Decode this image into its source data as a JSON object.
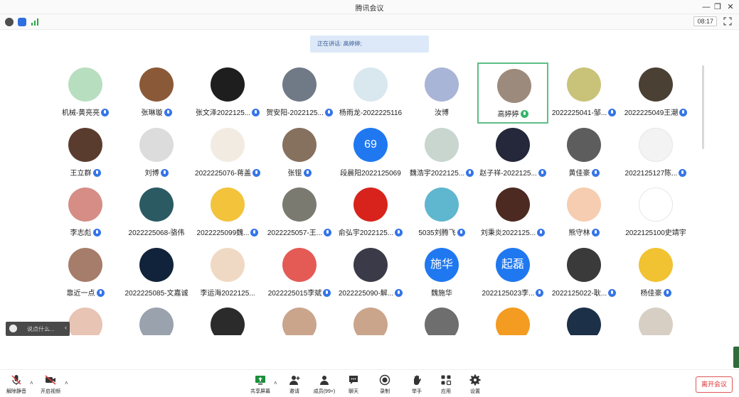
{
  "window": {
    "title": "腾讯会议"
  },
  "subbar": {
    "time": "08:17"
  },
  "speaking": {
    "text": "正在讲话: 高婷婷;"
  },
  "participants": [
    {
      "name": "机械-黄亮亮",
      "color": "#b8dec0",
      "mic": "blue"
    },
    {
      "name": "张琳璇",
      "color": "#8a5a38",
      "mic": "blue"
    },
    {
      "name": "张文泽2022125...",
      "color": "#1e1e1e",
      "mic": "blue"
    },
    {
      "name": "贺安阳-2022125...",
      "color": "#6f7a86",
      "mic": "blue"
    },
    {
      "name": "杨雨龙-2022225116",
      "color": "#d9e7ee",
      "mic": ""
    },
    {
      "name": "汝博",
      "color": "#a9b5d6",
      "mic": ""
    },
    {
      "name": "高婷婷",
      "color": "#9c8a7c",
      "mic": "green",
      "active": true
    },
    {
      "name": "2022225041-邹...",
      "color": "#c9c37a",
      "mic": "blue"
    },
    {
      "name": "2022225049王潮",
      "color": "#4a4034",
      "mic": "blue"
    },
    {
      "name": "王立群",
      "color": "#5a3c2e",
      "mic": "blue"
    },
    {
      "name": "刘博",
      "color": "#dcdcdc",
      "mic": "blue"
    },
    {
      "name": "2022225076-蒋盖",
      "color": "#f1ebe2",
      "mic": "blue"
    },
    {
      "name": "张锟",
      "color": "#86705e",
      "mic": "blue"
    },
    {
      "name": "段晨阳2022125069",
      "color": "#1f78f0",
      "mic": "",
      "text": "69"
    },
    {
      "name": "魏浩宇2022125...",
      "color": "#c8d6cf",
      "mic": "blue"
    },
    {
      "name": "赵子祥-2022125...",
      "color": "#24283a",
      "mic": "blue"
    },
    {
      "name": "黄佳豪",
      "color": "#5d5d5d",
      "mic": "blue"
    },
    {
      "name": "2022125127陈...",
      "color": "#f3f3f3",
      "mic": "blue"
    },
    {
      "name": "李志彪",
      "color": "#d58d86",
      "mic": "blue"
    },
    {
      "name": "2022225068-骆伟",
      "color": "#2b5a63",
      "mic": ""
    },
    {
      "name": "2022225099魏...",
      "color": "#f2c33b",
      "mic": "blue"
    },
    {
      "name": "2022225057-王...",
      "color": "#7a7a70",
      "mic": "blue"
    },
    {
      "name": "俞弘宇2022125...",
      "color": "#d8231c",
      "mic": "blue"
    },
    {
      "name": "5035刘腾飞",
      "color": "#5fb6cf",
      "mic": "blue"
    },
    {
      "name": "刘秉炎2022125...",
      "color": "#4c2a22",
      "mic": "blue"
    },
    {
      "name": "熊守林",
      "color": "#f6cdb0",
      "mic": "blue"
    },
    {
      "name": "2022125100史靖宇",
      "color": "#ffffff",
      "mic": ""
    },
    {
      "name": "靠近一点",
      "color": "#a67c6a",
      "mic": "blue"
    },
    {
      "name": "2022225085-文嘉诚",
      "color": "#11233a",
      "mic": ""
    },
    {
      "name": "李运海2022125...",
      "color": "#f0d9c4",
      "mic": ""
    },
    {
      "name": "2022225015李斌",
      "color": "#e45b55",
      "mic": "blue"
    },
    {
      "name": "2022225090-解...",
      "color": "#3b3a48",
      "mic": "blue"
    },
    {
      "name": "魏施华",
      "color": "#1f78f0",
      "mic": "",
      "text": "施华"
    },
    {
      "name": "2022125023李...",
      "color": "#1f78f0",
      "mic": "blue",
      "text": "起磊"
    },
    {
      "name": "2022125022-耿...",
      "color": "#3a3a3a",
      "mic": "blue"
    },
    {
      "name": "杨佳豪",
      "color": "#f1c231",
      "mic": "blue"
    },
    {
      "name": "",
      "color": "#e8c4b4",
      "mic": ""
    },
    {
      "name": "",
      "color": "#9aa3ad",
      "mic": ""
    },
    {
      "name": "",
      "color": "#2b2b2b",
      "mic": ""
    },
    {
      "name": "",
      "color": "#caa58c",
      "mic": ""
    },
    {
      "name": "",
      "color": "#caa58c",
      "mic": ""
    },
    {
      "name": "",
      "color": "#6e6e6e",
      "mic": ""
    },
    {
      "name": "",
      "color": "#f39c21",
      "mic": ""
    },
    {
      "name": "",
      "color": "#1c3148",
      "mic": ""
    },
    {
      "name": "",
      "color": "#d7cfc4",
      "mic": ""
    }
  ],
  "chat": {
    "placeholder": "说点什么..."
  },
  "toolbar": {
    "mute": "解除静音",
    "video": "开启视频",
    "share": "共享屏幕",
    "invite": "邀请",
    "members": "成员(99+)",
    "chat": "聊天",
    "record": "录制",
    "raise": "举手",
    "apps": "应用",
    "settings": "设置",
    "leave": "离开会议"
  },
  "colors": {
    "accent": "#1f78f0",
    "active_border": "#5cbf86",
    "leave": "#d33333"
  }
}
